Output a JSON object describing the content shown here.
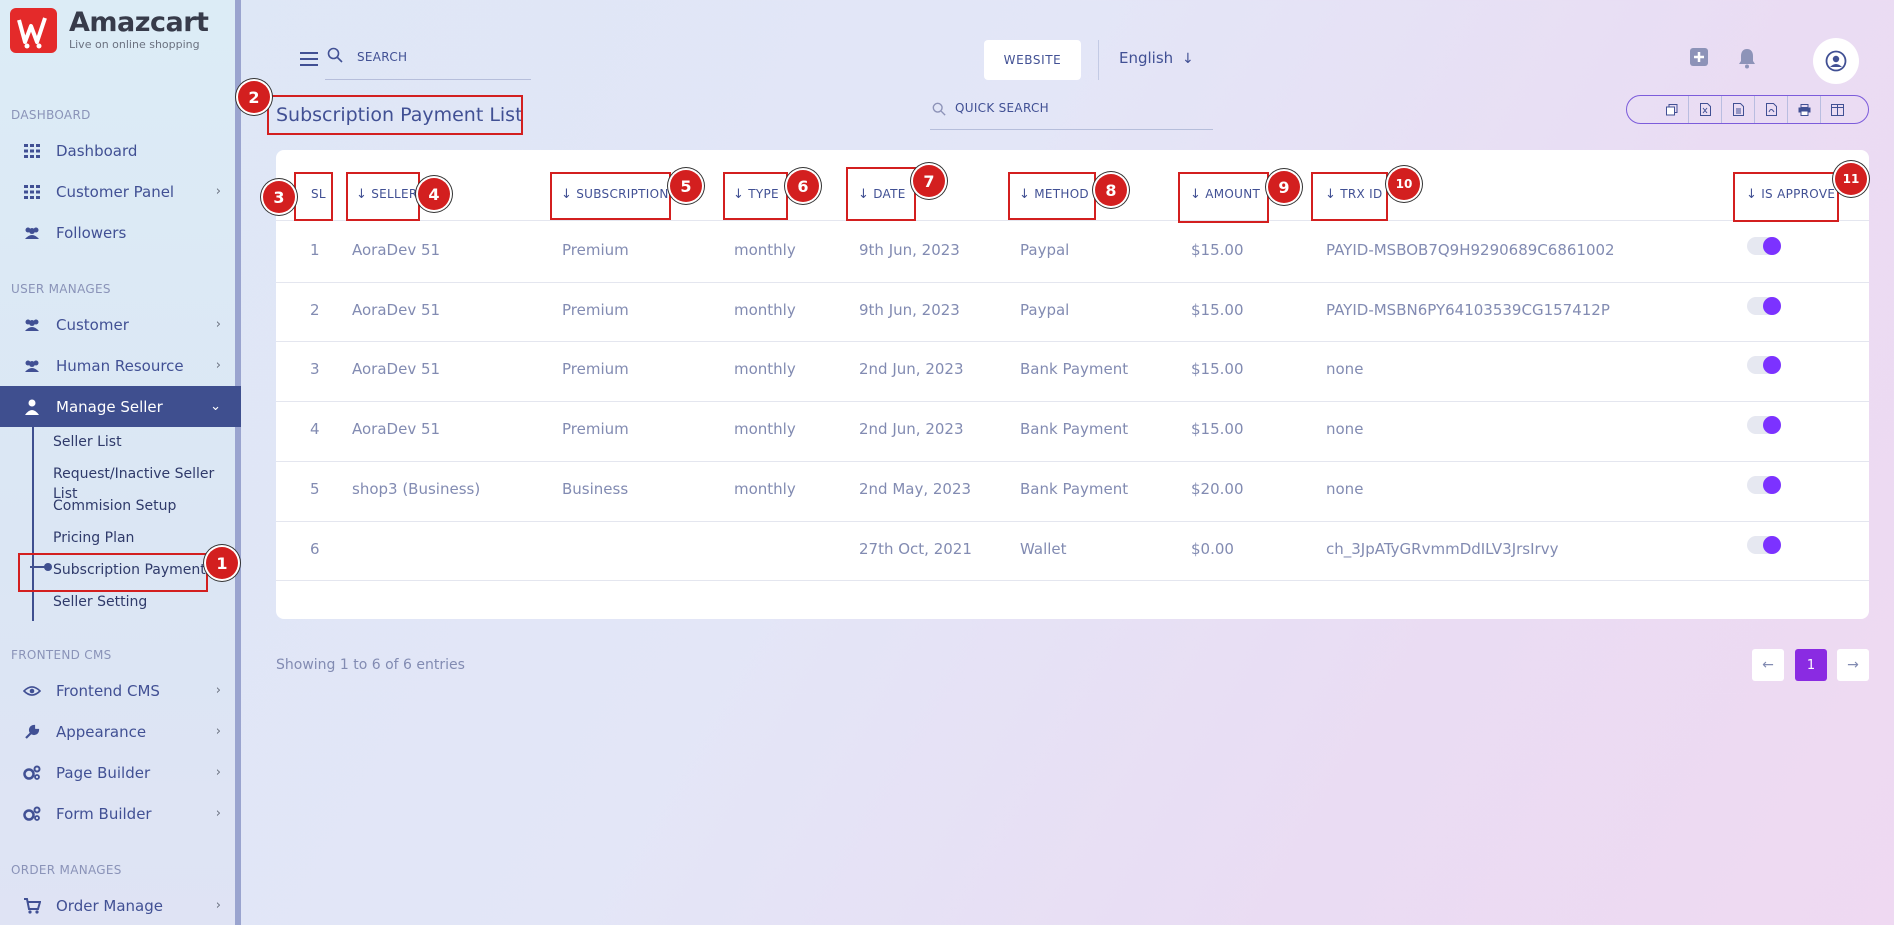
{
  "brand": {
    "name": "Amazcart",
    "tagline": "Live on online shopping"
  },
  "sidebar": {
    "sections": {
      "dashboard": "DASHBOARD",
      "user_manages": "USER MANAGES",
      "frontend_cms": "FRONTEND CMS",
      "order_manages": "ORDER MANAGES"
    },
    "items": {
      "dashboard": "Dashboard",
      "customer_panel": "Customer Panel",
      "followers": "Followers",
      "customer": "Customer",
      "human_resource": "Human Resource",
      "manage_seller": "Manage Seller",
      "frontend_cms": "Frontend CMS",
      "appearance": "Appearance",
      "page_builder": "Page Builder",
      "form_builder": "Form Builder",
      "order_manage": "Order Manage"
    },
    "submenu": [
      "Seller List",
      "Request/Inactive Seller List",
      "Commision Setup",
      "Pricing Plan",
      "Subscription Payment",
      "Seller Setting"
    ]
  },
  "header": {
    "search_label": "SEARCH",
    "website_button": "WEBSITE",
    "language": "English"
  },
  "page": {
    "title": "Subscription Payment List",
    "quick_search": "QUICK SEARCH"
  },
  "table": {
    "headers": {
      "sl": "SL",
      "seller": "SELLER",
      "subscription": "SUBSCRIPTION",
      "type": "TYPE",
      "date": "DATE",
      "method": "METHOD",
      "amount": "AMOUNT",
      "trx_id": "TRX ID",
      "is_approve": "IS APPROVE"
    },
    "rows": [
      {
        "sl": "1",
        "seller": "AoraDev 51",
        "subscription": "Premium",
        "type": "monthly",
        "date": "9th Jun, 2023",
        "method": "Paypal",
        "amount": "$15.00",
        "trx_id": "PAYID-MSBOB7Q9H9290689C6861002",
        "approved": true
      },
      {
        "sl": "2",
        "seller": "AoraDev 51",
        "subscription": "Premium",
        "type": "monthly",
        "date": "9th Jun, 2023",
        "method": "Paypal",
        "amount": "$15.00",
        "trx_id": "PAYID-MSBN6PY64103539CG157412P",
        "approved": true
      },
      {
        "sl": "3",
        "seller": "AoraDev 51",
        "subscription": "Premium",
        "type": "monthly",
        "date": "2nd Jun, 2023",
        "method": "Bank Payment",
        "amount": "$15.00",
        "trx_id": "none",
        "approved": true
      },
      {
        "sl": "4",
        "seller": "AoraDev 51",
        "subscription": "Premium",
        "type": "monthly",
        "date": "2nd Jun, 2023",
        "method": "Bank Payment",
        "amount": "$15.00",
        "trx_id": "none",
        "approved": true
      },
      {
        "sl": "5",
        "seller": "shop3 (Business)",
        "subscription": "Business",
        "type": "monthly",
        "date": "2nd May, 2023",
        "method": "Bank Payment",
        "amount": "$20.00",
        "trx_id": "none",
        "approved": true
      },
      {
        "sl": "6",
        "seller": "",
        "subscription": "",
        "type": "",
        "date": "27th Oct, 2021",
        "method": "Wallet",
        "amount": "$0.00",
        "trx_id": "ch_3JpATyGRvmmDdILV3JrsIrvy",
        "approved": true
      }
    ]
  },
  "footer": {
    "showing": "Showing 1 to 6 of 6 entries",
    "current_page": "1"
  },
  "annotations": [
    "1",
    "2",
    "3",
    "4",
    "5",
    "6",
    "7",
    "8",
    "9",
    "10",
    "11"
  ]
}
